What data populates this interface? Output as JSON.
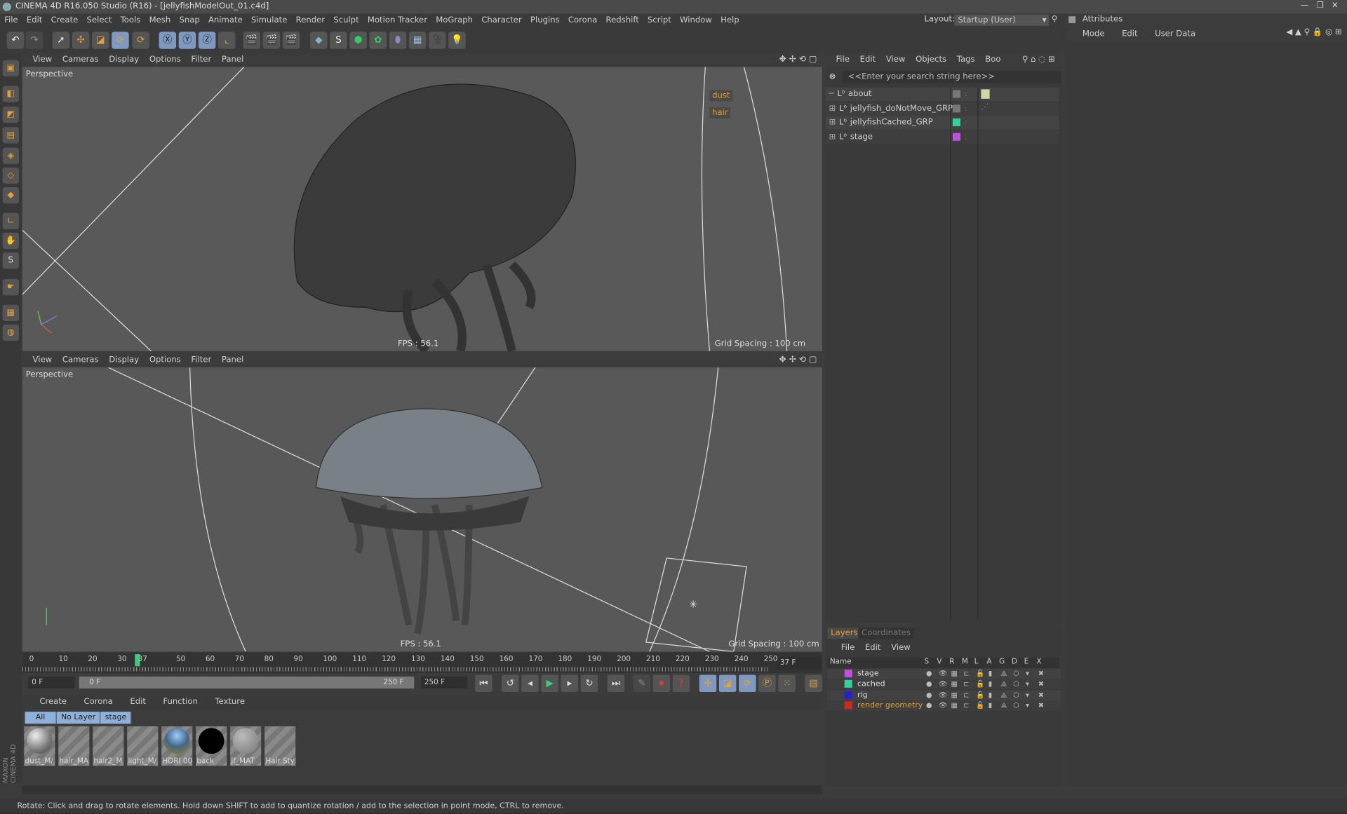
{
  "window": {
    "title": "CINEMA 4D R16.050 Studio (R16) - [jellyfishModelOut_01.c4d]"
  },
  "menu": [
    "File",
    "Edit",
    "Create",
    "Select",
    "Tools",
    "Mesh",
    "Snap",
    "Animate",
    "Simulate",
    "Render",
    "Sculpt",
    "Motion Tracker",
    "MoGraph",
    "Character",
    "Plugins",
    "Corona",
    "Redshift",
    "Script",
    "Window",
    "Help"
  ],
  "layout": {
    "label": "Layout:",
    "value": "Startup (User)"
  },
  "viewport_menu": [
    "View",
    "Cameras",
    "Display",
    "Options",
    "Filter",
    "Panel"
  ],
  "viewport_top": {
    "label": "Perspective",
    "fps": "FPS : 56.1",
    "grid": "Grid Spacing : 100 cm",
    "tags": [
      "dust",
      "hair"
    ]
  },
  "viewport_bottom": {
    "label": "Perspective",
    "fps": "FPS : 56.1",
    "grid": "Grid Spacing : 100 cm"
  },
  "object_manager": {
    "menu": [
      "File",
      "Edit",
      "View",
      "Objects",
      "Tags",
      "Boo"
    ],
    "search_placeholder": "<<Enter your search string here>>",
    "objects": [
      {
        "name": "about",
        "color": "#777777"
      },
      {
        "name": "jellyfish_doNotMove_GRP",
        "color": "#777777"
      },
      {
        "name": "jellyfishCached_GRP",
        "color": "#2fd39a"
      },
      {
        "name": "stage",
        "color": "#c24fe0"
      }
    ]
  },
  "attributes": {
    "title": "Attributes",
    "menu": [
      "Mode",
      "Edit",
      "User Data"
    ]
  },
  "layers": {
    "tabs": [
      "Layers",
      "Coordinates"
    ],
    "menu": [
      "File",
      "Edit",
      "View"
    ],
    "columns": [
      "Name",
      "S",
      "V",
      "R",
      "M",
      "L",
      "A",
      "G",
      "D",
      "E",
      "X"
    ],
    "rows": [
      {
        "name": "stage",
        "color": "#c24fe0"
      },
      {
        "name": "cached",
        "color": "#2fd39a"
      },
      {
        "name": "rig",
        "color": "#2a1fd0"
      },
      {
        "name": "render geometry",
        "color": "#d02a1f"
      }
    ]
  },
  "timeline": {
    "ticks": [
      "0",
      "10",
      "20",
      "30",
      "37",
      "50",
      "60",
      "70",
      "80",
      "90",
      "100",
      "110",
      "120",
      "130",
      "140",
      "150",
      "160",
      "170",
      "180",
      "190",
      "200",
      "210",
      "220",
      "230",
      "240",
      "250"
    ],
    "current_frame": "37 F",
    "current": 37,
    "start": "0 F",
    "range_start": "0 F",
    "range_end": "250 F",
    "end": "250 F"
  },
  "material_manager": {
    "menu": [
      "Create",
      "Corona",
      "Edit",
      "Function",
      "Texture"
    ],
    "filters": [
      "All",
      "No Layer",
      "stage"
    ],
    "materials": [
      "dust_M/",
      "hair_MA",
      "hair2_M",
      "light_M/",
      "HDRI 00",
      "back",
      "jf_MAT",
      "Hair Styl"
    ]
  },
  "branding": "MAXON CINEMA 4D",
  "status": "Rotate: Click and drag to rotate elements. Hold down SHIFT to add to quantize rotation / add to the selection in point mode, CTRL to remove."
}
